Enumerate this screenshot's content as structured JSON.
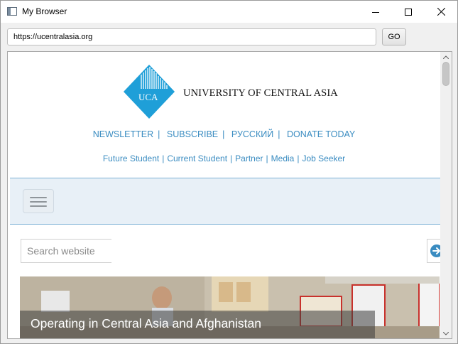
{
  "window": {
    "title": "My Browser",
    "controls": [
      "minimize",
      "maximize",
      "close"
    ]
  },
  "urlbar": {
    "url": "https://ucentralasia.org",
    "go_label": "GO"
  },
  "site": {
    "logo": {
      "mark_text": "UCA",
      "name": "UNIVERSITY OF CENTRAL ASIA"
    },
    "top_links": [
      "NEWSLETTER",
      "SUBSCRIBE",
      "РУССКИЙ",
      "DONATE TODAY"
    ],
    "audience_links": [
      "Future Student",
      "Current Student",
      "Partner",
      "Media",
      "Job Seeker"
    ],
    "search_placeholder": "Search website",
    "hero_caption": "Operating in Central Asia and Afghanistan"
  },
  "colors": {
    "link": "#3a8cc1",
    "logo_blue": "#1f9fd8",
    "nav_band": "#e8f0f7"
  }
}
